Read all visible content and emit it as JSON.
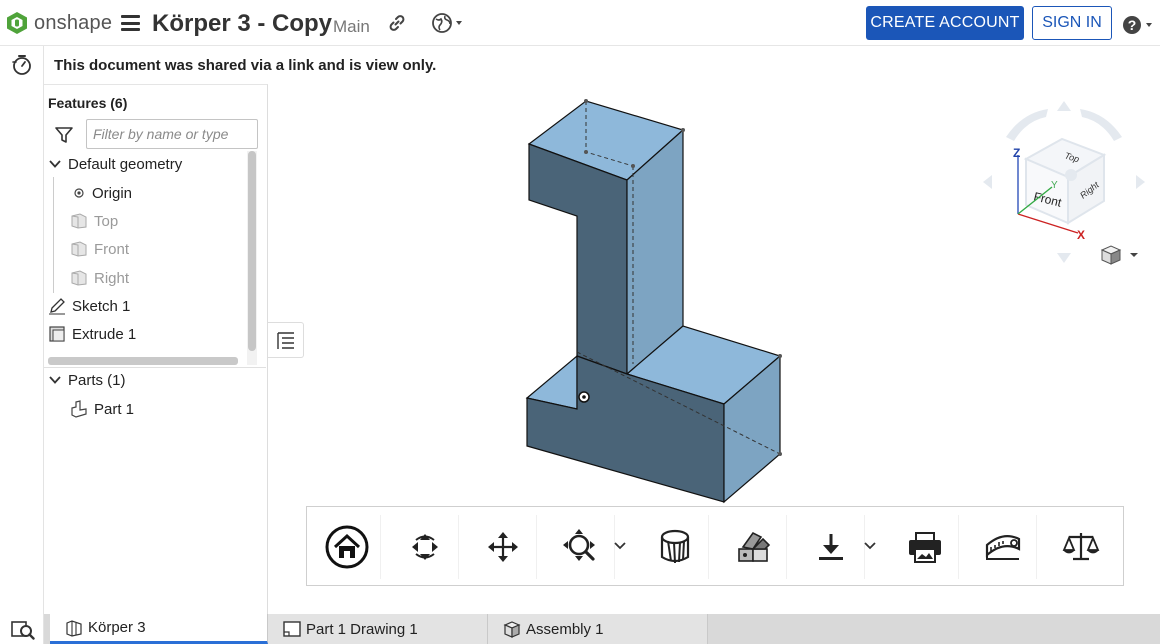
{
  "header": {
    "logo_text": "onshape",
    "document_title": "Körper 3 - Copy",
    "branch": "Main",
    "create_account_label": "CREATE ACCOUNT",
    "sign_in_label": "SIGN IN"
  },
  "notice": "This document was shared via a link and is view only.",
  "feature_panel": {
    "title": "Features (6)",
    "filter_placeholder": "Filter by name or type",
    "default_geometry_label": "Default geometry",
    "origin_label": "Origin",
    "plane_top_label": "Top",
    "plane_front_label": "Front",
    "plane_right_label": "Right",
    "sketch_label": "Sketch 1",
    "extrude_label": "Extrude 1",
    "parts_label": "Parts (1)",
    "part_label": "Part 1"
  },
  "view_cube": {
    "face_front": "Front",
    "face_top": "Top",
    "face_right": "Right",
    "axis_x": "X",
    "axis_y": "Y",
    "axis_z": "Z"
  },
  "toolbar": {
    "tools": [
      "home-icon",
      "rotate-icon",
      "pan-icon",
      "zoom-icon",
      "section-view-icon",
      "appearance-icon",
      "export-icon",
      "print-icon",
      "measure-icon",
      "mass-properties-icon"
    ]
  },
  "tabs": {
    "part_studio": "Körper 3",
    "drawing": "Part 1 Drawing 1",
    "assembly": "Assembly 1"
  },
  "colors": {
    "accent": "#1b56b8",
    "part_top": "#8eb8da",
    "part_side": "#4a6478",
    "part_face": "#7ca2bf",
    "active_tab_underline": "#2a6fd6"
  }
}
